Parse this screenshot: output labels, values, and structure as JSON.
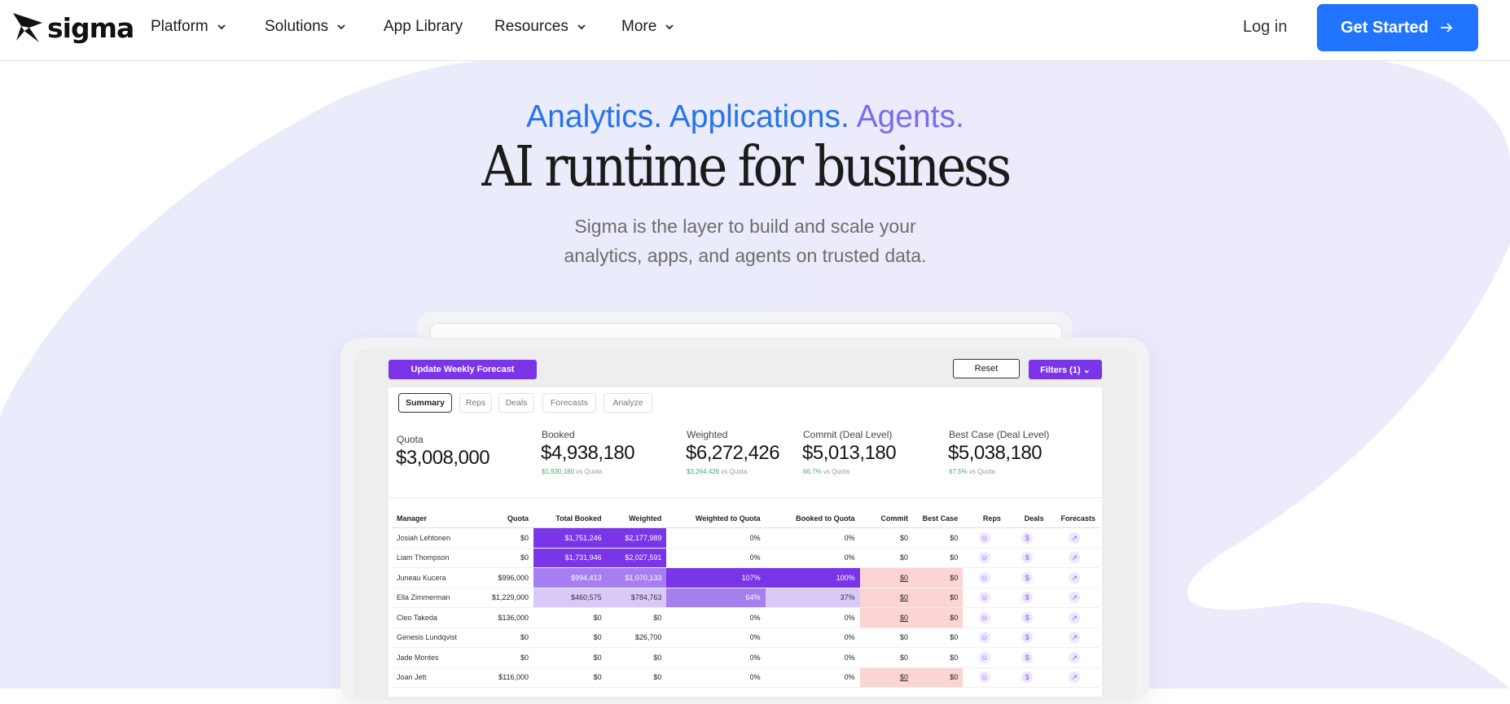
{
  "colors": {
    "accent": "#2074ff",
    "purple": "#7a35e8",
    "eyebrow_blue": "#2774ea",
    "eyebrow_violet": "#7a6cf0"
  },
  "nav": {
    "logo_text": "sigma",
    "items": [
      {
        "label": "Platform",
        "has_dropdown": true
      },
      {
        "label": "Solutions",
        "has_dropdown": true
      },
      {
        "label": "App Library",
        "has_dropdown": false
      },
      {
        "label": "Resources",
        "has_dropdown": true
      },
      {
        "label": "More",
        "has_dropdown": true
      }
    ],
    "login_label": "Log in",
    "cta_label": "Get Started",
    "cta_icon": "arrow-right-icon"
  },
  "hero": {
    "eyebrow_part1": "Analytics. Applications.",
    "eyebrow_part2": "Agents.",
    "headline": "AI runtime for business",
    "sub_line1": "Sigma is the layer to build and scale your",
    "sub_line2": "analytics, apps, and agents on trusted data."
  },
  "dashboard": {
    "update_button": "Update Weekly Forecast",
    "reset_button": "Reset",
    "filters_button": "Filters (1) ⌄",
    "tabs": [
      "Summary",
      "Reps",
      "Deals",
      "Forecasts",
      "Analyze"
    ],
    "kpis": [
      {
        "label": "Quota",
        "value": "$3,008,000",
        "delta": "",
        "note": ""
      },
      {
        "label": "Booked",
        "value": "$4,938,180",
        "delta": "$1,930,180",
        "note": "vs Quota"
      },
      {
        "label": "Weighted",
        "value": "$6,272,426",
        "delta": "$3,264,426",
        "note": "vs Quota"
      },
      {
        "label": "Commit (Deal Level)",
        "value": "$5,013,180",
        "delta": "66.7%",
        "note": "vs Quota"
      },
      {
        "label": "Best Case (Deal Level)",
        "value": "$5,038,180",
        "delta": "67.5%",
        "note": "vs Quota"
      }
    ],
    "columns": [
      "Manager",
      "Quota",
      "Total Booked",
      "Weighted",
      "Weighted to Quota",
      "Booked to Quota",
      "Commit",
      "Best Case",
      "Reps",
      "Deals",
      "Forecasts"
    ],
    "rows": [
      {
        "manager": "Josiah Lehtonen",
        "quota": "$0",
        "booked": "$1,751,246",
        "weighted": "$2,177,989",
        "wq": "0%",
        "bq": "0%",
        "commit": "$0",
        "best": "$0"
      },
      {
        "manager": "Liam Thompson",
        "quota": "$0",
        "booked": "$1,731,946",
        "weighted": "$2,027,591",
        "wq": "0%",
        "bq": "0%",
        "commit": "$0",
        "best": "$0"
      },
      {
        "manager": "Juneau Kucera",
        "quota": "$996,000",
        "booked": "$994,413",
        "weighted": "$1,070,133",
        "wq": "107%",
        "bq": "100%",
        "commit": "$0",
        "best": "$0"
      },
      {
        "manager": "Ella Zimmerman",
        "quota": "$1,229,000",
        "booked": "$460,575",
        "weighted": "$784,763",
        "wq": "64%",
        "bq": "37%",
        "commit": "$0",
        "best": "$0"
      },
      {
        "manager": "Cleo Takeda",
        "quota": "$136,000",
        "booked": "$0",
        "weighted": "$0",
        "wq": "0%",
        "bq": "0%",
        "commit": "$0",
        "best": "$0"
      },
      {
        "manager": "Genesis Lundqvist",
        "quota": "$0",
        "booked": "$0",
        "weighted": "$26,700",
        "wq": "0%",
        "bq": "0%",
        "commit": "$0",
        "best": "$0"
      },
      {
        "manager": "Jade Montes",
        "quota": "$0",
        "booked": "$0",
        "weighted": "$0",
        "wq": "0%",
        "bq": "0%",
        "commit": "$0",
        "best": "$0"
      },
      {
        "manager": "Joan Jett",
        "quota": "$116,000",
        "booked": "$0",
        "weighted": "$0",
        "wq": "0%",
        "bq": "0%",
        "commit": "$0",
        "best": "$0"
      }
    ]
  }
}
